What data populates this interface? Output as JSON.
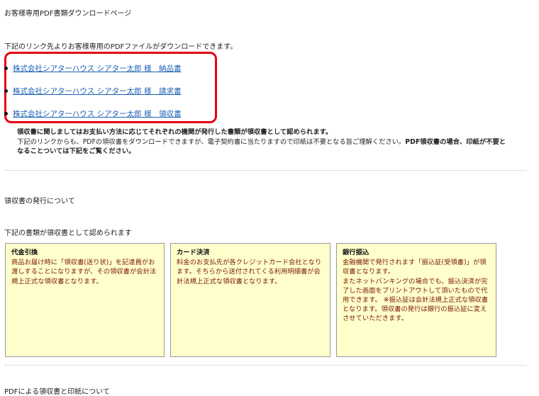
{
  "page": {
    "title": "お客様専用PDF書類ダウンロードページ",
    "intro": "下記のリンク先よりお客様専用のPDFファイルがダウンロードできます。"
  },
  "links": [
    {
      "label": "株式会社シアターハウス シアター太郎 様　納品書"
    },
    {
      "label": "株式会社シアターハウス シアター太郎 様　請求書"
    },
    {
      "label": "株式会社シアターハウス シアター太郎 様　領収書"
    }
  ],
  "note": {
    "line1": "領収書に関しましてはお支払い方法に応じてそれぞれの機関が発行した書類が領収書として認められます。",
    "line2_pre": "下記のリンクからも、PDFの領収書をダウンロードできますが、電子契約書に当たりますので印紙は不要となる旨ご理解ください。",
    "line2_bold": "PDF領収書の場合、印紙が不要と",
    "line3": "なることついては下記をご覧ください。"
  },
  "receipt_section": {
    "heading": "領収書の発行について",
    "subheading": "下記の書類が領収書として認められます",
    "boxes": [
      {
        "title": "代金引換",
        "body": "商品お届け時に「領収書(送り状)」を記達員がお渡しすることになりますが、その領収書が会計法規上正式な領収書となります。"
      },
      {
        "title": "カード決済",
        "body": "料金のお支払先が各クレジットカード会社となります。そちらから送付されてくる利用明細書が会計法規上正式な領収書となります。"
      },
      {
        "title": "銀行振込",
        "body": "金融機関で発行されます「振込証(受領書)」が領収書となります。\nまたネットバンキングの場合でも、振込決済が完了した画面をプリントアウトして頂いたもので代用できます。 ※振込証は会計法規上正式な領収書となります。領収書の発行は銀行の振込証に変えさせていただきます。"
      }
    ]
  },
  "cut_heading": "PDFによる領収書と印紙について",
  "colors": {
    "link": "#1a5fb4",
    "highlight_border": "#e60012",
    "box_bg": "#ffffcc",
    "box_body_text": "#7a1a00"
  }
}
